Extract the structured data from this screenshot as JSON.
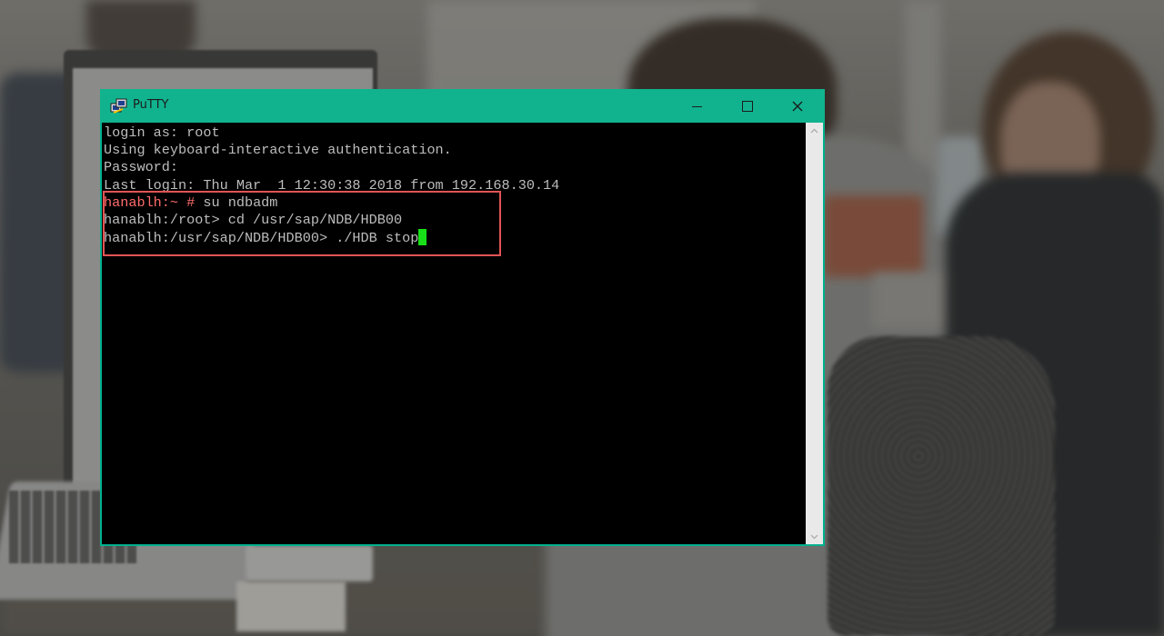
{
  "window": {
    "title": "PuTTY",
    "titlebar_color": "#11b38f",
    "close_glyph": "✕"
  },
  "terminal": {
    "lines": [
      {
        "text": "login as: root"
      },
      {
        "text": "Using keyboard-interactive authentication."
      },
      {
        "text": "Password:"
      },
      {
        "text": "Last login: Thu Mar  1 12:30:38 2018 from 192.168.30.14"
      },
      {
        "prompt": "hanablh:~ #",
        "command": " su ndbadm"
      },
      {
        "text": "hanablh:/root> cd /usr/sap/NDB/HDB00"
      },
      {
        "text": "hanablh:/usr/sap/NDB/HDB00> ./HDB stop"
      }
    ],
    "cursor_color": "#18e018",
    "prompt_color": "#ff6b6b",
    "highlight_color": "#e25454"
  }
}
